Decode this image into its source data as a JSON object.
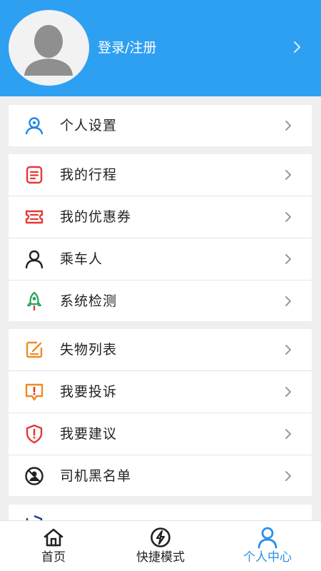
{
  "header": {
    "login_label": "登录/注册"
  },
  "sections": [
    {
      "items": [
        {
          "label": "个人设置",
          "icon": "user-settings-icon"
        }
      ]
    },
    {
      "items": [
        {
          "label": "我的行程",
          "icon": "trip-list-icon"
        },
        {
          "label": "我的优惠券",
          "icon": "coupon-icon"
        },
        {
          "label": "乘车人",
          "icon": "passenger-icon"
        },
        {
          "label": "系统检测",
          "icon": "rocket-icon"
        }
      ]
    },
    {
      "items": [
        {
          "label": "失物列表",
          "icon": "edit-note-icon"
        },
        {
          "label": "我要投诉",
          "icon": "complaint-icon"
        },
        {
          "label": "我要建议",
          "icon": "shield-suggest-icon"
        },
        {
          "label": "司机黑名单",
          "icon": "blacklist-icon"
        }
      ]
    }
  ],
  "tabbar": {
    "tabs": [
      {
        "label": "首页",
        "icon": "home-icon",
        "active": false
      },
      {
        "label": "快捷模式",
        "icon": "lightning-icon",
        "active": false
      },
      {
        "label": "个人中心",
        "icon": "person-icon",
        "active": true
      }
    ]
  },
  "colors": {
    "header_bg": "#2ea0f2",
    "accent": "#2a8fe6",
    "icon_blue": "#1e88e5",
    "icon_red": "#e53935",
    "icon_green": "#27a35a",
    "icon_orange": "#f08a24"
  }
}
